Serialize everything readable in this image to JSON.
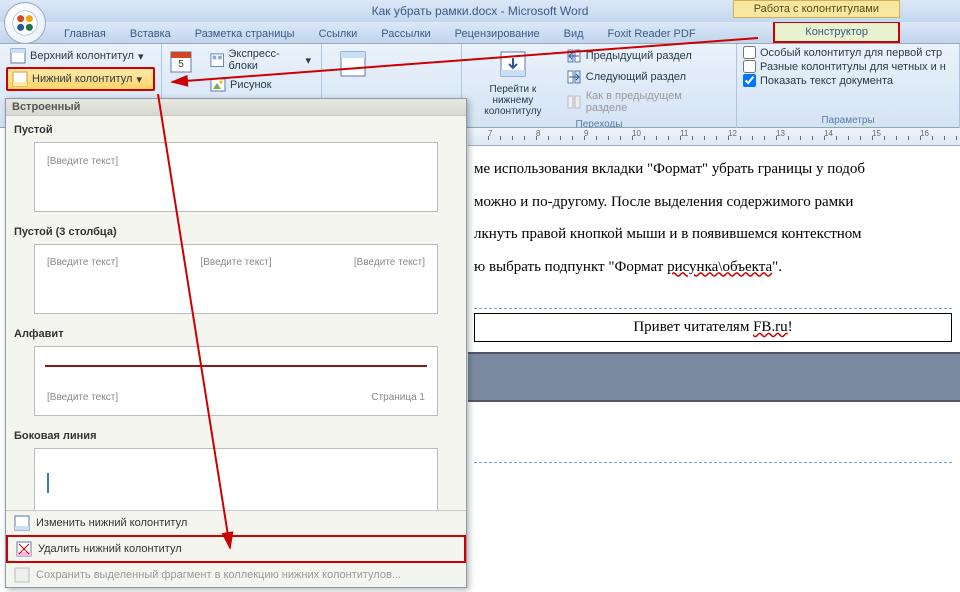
{
  "title": "Как убрать рамки.docx - Microsoft Word",
  "context_tab_title": "Работа с колонтитулами",
  "tabs": {
    "home": "Главная",
    "insert": "Вставка",
    "layout": "Разметка страницы",
    "refs": "Ссылки",
    "mail": "Рассылки",
    "review": "Рецензирование",
    "view": "Вид",
    "foxit": "Foxit Reader PDF",
    "designer": "Конструктор"
  },
  "ribbon": {
    "hf": {
      "top": "Верхний колонтитул",
      "bottom": "Нижний колонтитул"
    },
    "insert": {
      "express": "Экспресс-блоки",
      "picture": "Рисунок"
    },
    "nav": {
      "goto_bottom": "Перейти к нижнему колонтитулу",
      "prev_section": "Предыдущий раздел",
      "next_section": "Следующий раздел",
      "as_prev": "Как в предыдущем разделе",
      "group": "Переходы"
    },
    "options": {
      "first_page": "Особый колонтитул для первой стр",
      "odd_even": "Разные колонтитулы для четных и н",
      "show_text": "Показать текст документа",
      "group": "Параметры"
    }
  },
  "dropdown": {
    "header": "Встроенный",
    "s1": "Пустой",
    "s2": "Пустой (3 столбца)",
    "s3": "Алфавит",
    "s4": "Боковая линия",
    "ph": "[Введите текст]",
    "page_label": "Страница 1",
    "edit": "Изменить нижний колонтитул",
    "remove": "Удалить нижний колонтитул",
    "save": "Сохранить выделенный фрагмент в коллекцию нижних колонтитулов..."
  },
  "doc": {
    "p1": "ме использования вкладки \"Формат\" убрать границы у подоб",
    "p2": "можно и по-другому. После выделения содержимого рамки",
    "p3a": "лкнуть правой кнопкой мыши и в появившемся контекстном",
    "p3b": "ю выбрать подпункт \"Формат ",
    "p3c": "рисунка\\объекта",
    "p3d": "\".",
    "footer_a": "Привет читателям ",
    "footer_b": "FB.ru",
    "footer_c": "!"
  },
  "ruler": {
    "nums": [
      "7",
      "8",
      "9",
      "10",
      "11",
      "12",
      "13",
      "14",
      "15",
      "16"
    ]
  }
}
